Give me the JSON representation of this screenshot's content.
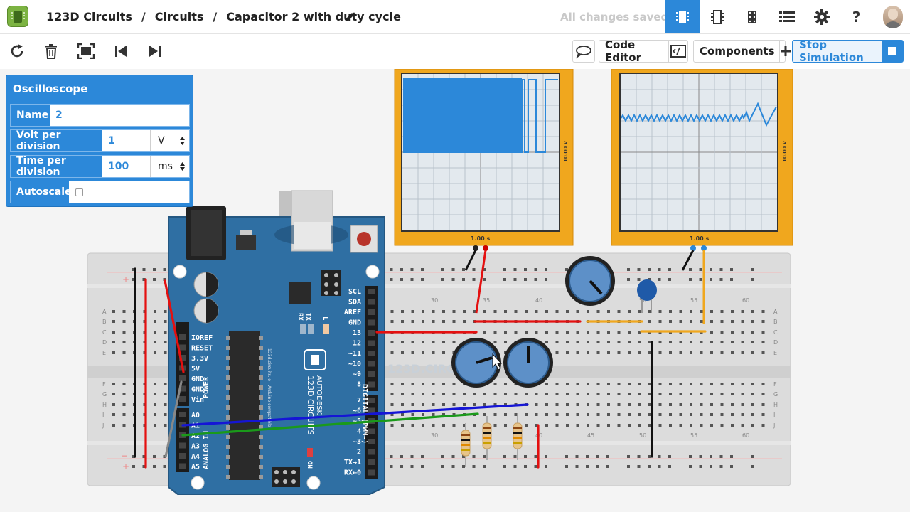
{
  "header": {
    "app_name": "123D Circuits",
    "breadcrumb_section": "Circuits",
    "separator": "/",
    "circuit_title": "Capacitor 2 with duty cycle",
    "save_status": "All changes saved",
    "accent_color": "#2c88d9",
    "icons": [
      "breadboard-view-icon",
      "schematic-view-icon",
      "pcb-view-icon",
      "parts-list-icon",
      "settings-icon",
      "help-icon"
    ],
    "help_label": "?"
  },
  "toolbar": {
    "code_editor_label": "Code Editor",
    "components_label": "Components",
    "stop_simulation_label": "Stop Simulation"
  },
  "oscilloscope_panel": {
    "title": "Oscilloscope",
    "name_label": "Name",
    "name_value": "2",
    "volt_label": "Volt per division",
    "volt_value": "1",
    "volt_unit": "V",
    "time_label": "Time per division",
    "time_value": "100",
    "time_unit": "ms",
    "autoscale_label": "Autoscale"
  },
  "scopes": [
    {
      "vertical_scale": "10.00 V",
      "horizontal_scale": "1.00 s"
    },
    {
      "vertical_scale": "10.00 V",
      "horizontal_scale": "1.00 s"
    }
  ],
  "arduino": {
    "power_pins": [
      "IOREF",
      "RESET",
      "3.3V",
      "5V",
      "GND",
      "GND",
      "Vin"
    ],
    "power_label": "POWER",
    "analog_pins": [
      "A0",
      "A1",
      "A2",
      "A3",
      "A4",
      "A5"
    ],
    "analog_label": "ANALOG IN",
    "digital_pins_top": [
      "SCL",
      "SDA",
      "AREF",
      "GND",
      "13",
      "12",
      "~11",
      "~10",
      "~9",
      "8"
    ],
    "digital_pins_bottom": [
      "7",
      "~6",
      "~5",
      "4",
      "~3",
      "2",
      "TX→1",
      "RX←0"
    ],
    "digital_label": "DIGITAL (PWM~)",
    "tx_label": "TX",
    "rx_label": "RX",
    "l_label": "L",
    "on_label": "ON",
    "brand_line1": "AUTODESK",
    "brand_line2": "123D CIRCUITS",
    "chip_text": "123d.circuits.io - Arduino compatible"
  },
  "breadboard": {
    "row_letters_top": [
      "A",
      "B",
      "C",
      "D",
      "E"
    ],
    "row_letters_bottom": [
      "F",
      "G",
      "H",
      "I",
      "J"
    ],
    "column_numbers": [
      "30",
      "35",
      "40",
      "45",
      "50",
      "55",
      "60"
    ],
    "watermark": "123D.CIRC",
    "plus_label": "+",
    "minus_label": "−"
  }
}
